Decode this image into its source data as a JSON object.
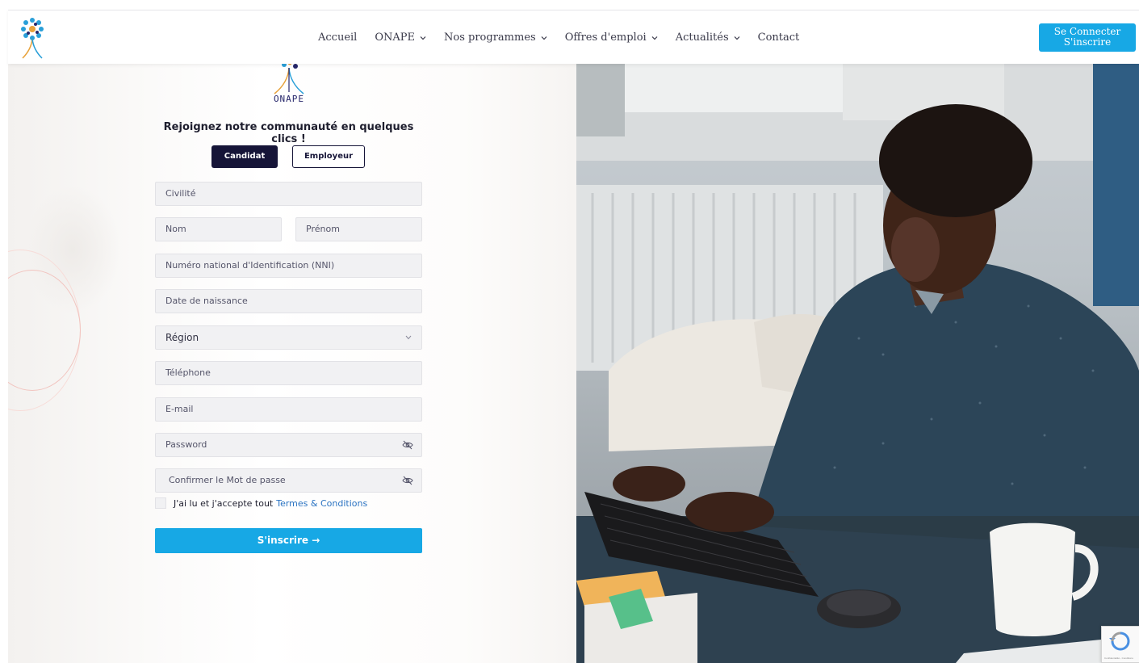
{
  "header": {
    "nav": [
      {
        "label": "Accueil",
        "dropdown": false
      },
      {
        "label": "ONAPE",
        "dropdown": true
      },
      {
        "label": "Nos programmes",
        "dropdown": true
      },
      {
        "label": "Offres d'emploi",
        "dropdown": true
      },
      {
        "label": "Actualités",
        "dropdown": true
      },
      {
        "label": "Contact",
        "dropdown": false
      }
    ],
    "connect_label": "Se Connecter",
    "register_label": "S'inscrire"
  },
  "form": {
    "brand": "ONAPE",
    "title": "Rejoignez notre communauté en quelques clics !",
    "tabs": {
      "candidat": "Candidat",
      "employeur": "Employeur"
    },
    "active_tab": "Candidat",
    "placeholders": {
      "civilite": "Civilité",
      "nom": "Nom",
      "prenom": "Prénom",
      "nni": "Numéro national d'Identification (NNI)",
      "date_naissance": "Date de naissance",
      "region": "Région",
      "telephone": "Téléphone",
      "email": "E-mail",
      "password": "Password",
      "confirm_password": "Confirmer le Mot de passe"
    },
    "terms_text": "J'ai lu et j'accepte tout",
    "terms_link": "Termes & Conditions",
    "submit_label": "S'inscrire →"
  },
  "recaptcha_text": "Confidentialité - Conditions",
  "colors": {
    "accent": "#17a8e5",
    "dark": "#161538",
    "link": "#2a73c2"
  },
  "icons": [
    "onape-logo-icon",
    "chevron-down-icon",
    "eye-slash-icon",
    "recaptcha-icon",
    "arrow-right-icon"
  ]
}
